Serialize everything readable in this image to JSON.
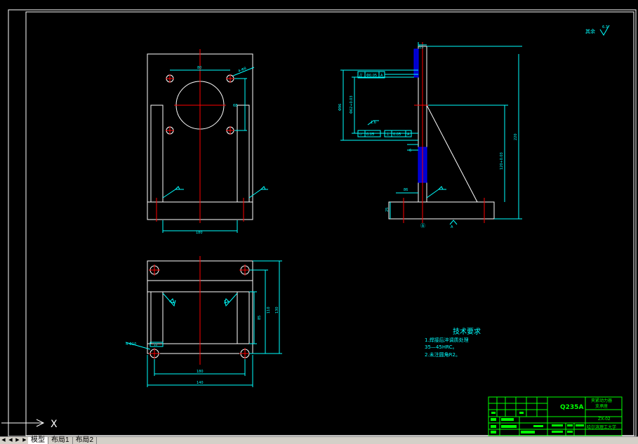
{
  "colors": {
    "background": "#000000",
    "outline": "#ffffff",
    "dimension": "#00ffff",
    "centerline": "#ff0000",
    "hatch": "#0000ff",
    "titleblock": "#00ff00",
    "crosshair": "#ffffff"
  },
  "drawing": {
    "roughness_symbol": "其余",
    "roughness_value": "6.3",
    "front_view": {
      "width_dim": "180",
      "hole_spacing": "80",
      "vert_dim": "68",
      "leader_note": "4-Φ8"
    },
    "side_view": {
      "tol1_symbol": "//",
      "tol1_value": "Φ0.05",
      "tol1_datum": "A",
      "tol2_symbol": "⌭",
      "tol2_value": "0.05",
      "tol3_symbol": "⊥",
      "tol3_value": "0.05",
      "tol3_datum": "A",
      "dim_top": "15",
      "dim_height": "220",
      "dim_inner": "120+0.03",
      "dim_left": "Φ96",
      "dim_left2": "Φ62+0.03",
      "dim_bottom_left": "86",
      "dim_base": "25",
      "dim_small": "6",
      "roughness_mark": "1.6",
      "datum_mark": "A",
      "circle_mark": "Ⓐ"
    },
    "top_view": {
      "width_dim": "180",
      "overall_dim": "140",
      "dim_right1": "85",
      "dim_right2": "110",
      "dim_right3": "130",
      "leader_note": "4-Φ10",
      "small_dim": "15"
    },
    "tech_req": {
      "title": "技术要求",
      "line1": "1.焊接后淬调质处理",
      "line2": "35—45HRC。",
      "line3": "2.未注圆角R2。"
    },
    "title_block": {
      "material": "Q235A",
      "name_line1": "夹紧动力器",
      "name_line2": "支承座",
      "drawing_no": "ZX-02",
      "school": "哈尔滨理工大学"
    },
    "ucs_label": "X"
  },
  "tabs": {
    "nav_first": "◀",
    "nav_prev": "◀",
    "nav_next": "▶",
    "nav_last": "▶",
    "model": "模型",
    "layout1": "布局1",
    "layout2": "布局2"
  }
}
